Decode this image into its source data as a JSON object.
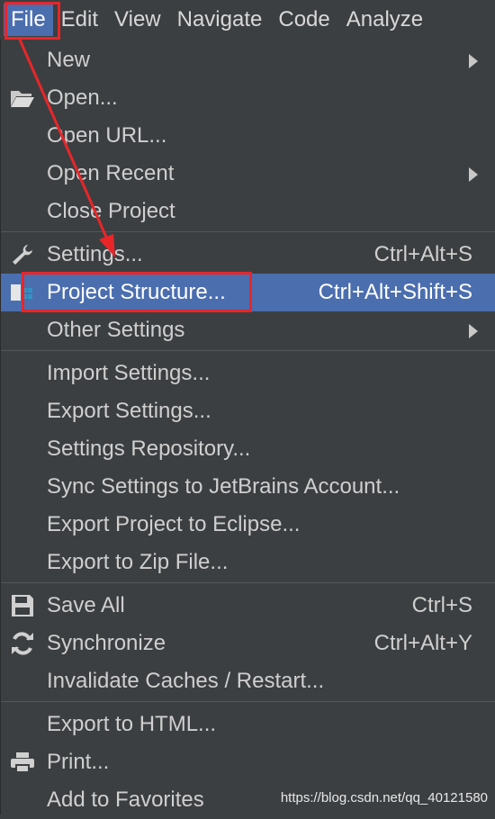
{
  "menubar": {
    "items": [
      "File",
      "Edit",
      "View",
      "Navigate",
      "Code",
      "Analyze"
    ]
  },
  "file_menu": {
    "new": {
      "label": "New"
    },
    "open": {
      "label": "Open..."
    },
    "open_url": {
      "label": "Open URL..."
    },
    "open_recent": {
      "label": "Open Recent"
    },
    "close_project": {
      "label": "Close Project"
    },
    "settings": {
      "label": "Settings...",
      "shortcut": "Ctrl+Alt+S"
    },
    "project_structure": {
      "label": "Project Structure...",
      "shortcut": "Ctrl+Alt+Shift+S"
    },
    "other_settings": {
      "label": "Other Settings"
    },
    "import_settings": {
      "label": "Import Settings..."
    },
    "export_settings": {
      "label": "Export Settings..."
    },
    "settings_repository": {
      "label": "Settings Repository..."
    },
    "sync_settings": {
      "label": "Sync Settings to JetBrains Account..."
    },
    "export_eclipse": {
      "label": "Export Project to Eclipse..."
    },
    "export_zip": {
      "label": "Export to Zip File..."
    },
    "save_all": {
      "label": "Save All",
      "shortcut": "Ctrl+S"
    },
    "synchronize": {
      "label": "Synchronize",
      "shortcut": "Ctrl+Alt+Y"
    },
    "invalidate_caches": {
      "label": "Invalidate Caches / Restart..."
    },
    "export_html": {
      "label": "Export to HTML..."
    },
    "print": {
      "label": "Print..."
    },
    "add_favorites": {
      "label": "Add to Favorites"
    }
  },
  "watermark": "https://blog.csdn.net/qq_40121580",
  "colors": {
    "background": "#3c3f41",
    "highlight": "#4b6eaf",
    "annotation": "#e8262a"
  }
}
